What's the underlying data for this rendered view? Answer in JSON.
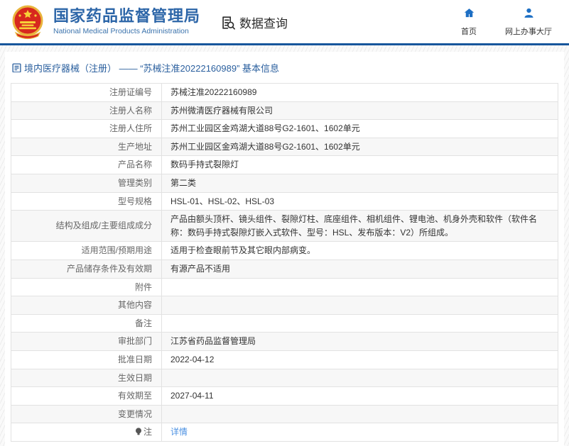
{
  "header": {
    "site_name_zh": "国家药品监督管理局",
    "site_name_en": "National Medical Products Administration",
    "section_title": "数据查询",
    "logo_icon": "national-emblem-logo",
    "section_icon": "document-search-icon",
    "nav": [
      {
        "label": "首页",
        "icon": "home-icon"
      },
      {
        "label": "网上办事大厅",
        "icon": "user-icon"
      }
    ]
  },
  "page": {
    "title_icon": "document-icon",
    "title": "境内医疗器械（注册） —— “苏械注准20222160989” 基本信息"
  },
  "table": {
    "rows": [
      {
        "label": "注册证编号",
        "value": "苏械注准20222160989"
      },
      {
        "label": "注册人名称",
        "value": "苏州微清医疗器械有限公司"
      },
      {
        "label": "注册人住所",
        "value": "苏州工业园区金鸡湖大道88号G2-1601、1602单元"
      },
      {
        "label": "生产地址",
        "value": "苏州工业园区金鸡湖大道88号G2-1601、1602单元"
      },
      {
        "label": "产品名称",
        "value": "数码手持式裂隙灯"
      },
      {
        "label": "管理类别",
        "value": "第二类"
      },
      {
        "label": "型号规格",
        "value": "HSL-01、HSL-02、HSL-03"
      },
      {
        "label": "结构及组成/主要组成成分",
        "value": "产品由额头顶杆、镜头组件、裂隙灯柱、底座组件、相机组件、锂电池、机身外壳和软件（软件名称：数码手持式裂隙灯嵌入式软件、型号：HSL、发布版本：V2）所组成。"
      },
      {
        "label": "适用范围/预期用途",
        "value": "适用于检查眼前节及其它眼内部病变。"
      },
      {
        "label": "产品储存条件及有效期",
        "value": "有源产品不适用"
      },
      {
        "label": "附件",
        "value": ""
      },
      {
        "label": "其他内容",
        "value": ""
      },
      {
        "label": "备注",
        "value": ""
      },
      {
        "label": "审批部门",
        "value": "江苏省药品监督管理局"
      },
      {
        "label": "批准日期",
        "value": "2022-04-12"
      },
      {
        "label": "生效日期",
        "value": ""
      },
      {
        "label": "有效期至",
        "value": "2027-04-11"
      },
      {
        "label": "变更情况",
        "value": ""
      },
      {
        "label": "注",
        "label_icon": "note-icon",
        "value": "详情",
        "value_is_link": true
      }
    ]
  },
  "colors": {
    "header_border": "#17569c",
    "brand_blue": "#2d66a8",
    "nav_icon_blue": "#1d6fc4",
    "title_blue": "#2a5f9e",
    "link_blue": "#4a90e2",
    "label_gray": "#666666",
    "value_dark": "#333333",
    "row_alt": "#f7f7f7",
    "table_border": "#e2e2e2"
  }
}
